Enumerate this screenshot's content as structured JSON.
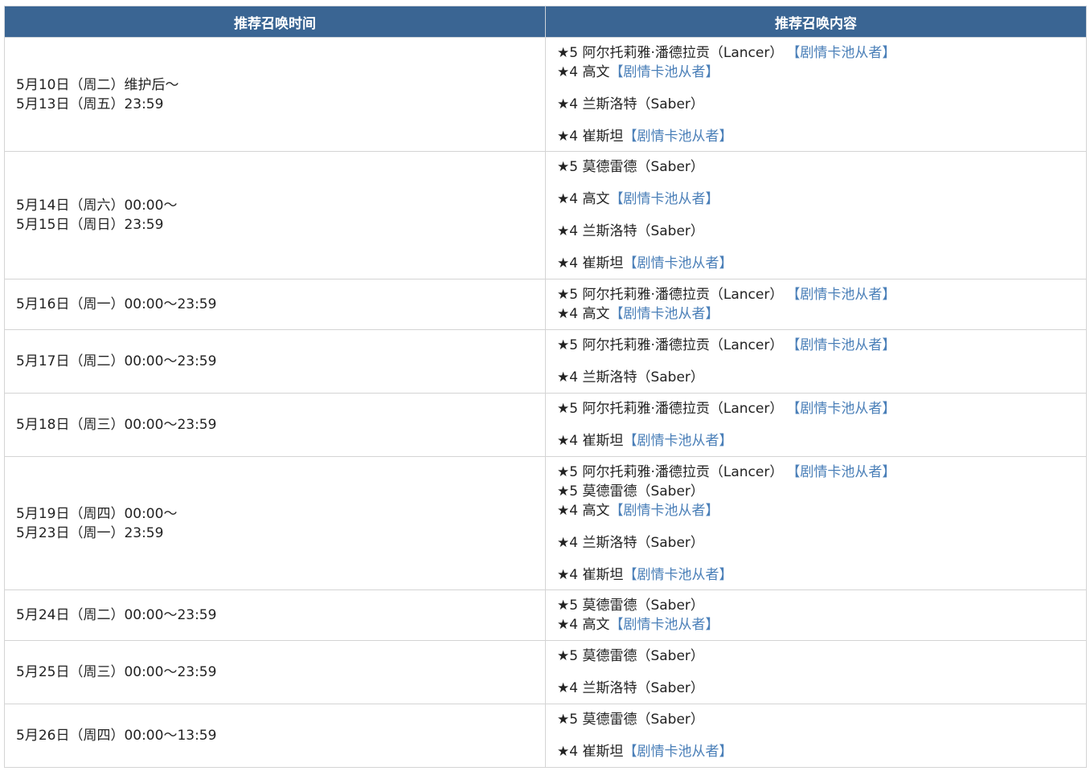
{
  "header": {
    "time_col": "推荐召唤时间",
    "content_col": "推荐召唤内容"
  },
  "rows": [
    {
      "time": [
        "5月10日（周二）维护后～",
        "5月13日（周五）23:59"
      ],
      "groups": [
        [
          {
            "text": "★5 阿尔托莉雅·潘德拉贡（Lancer）",
            "tag": "【剧情卡池从者】"
          },
          {
            "text": "★4 高文",
            "tag": "【剧情卡池从者】"
          }
        ],
        [
          {
            "text": "★4 兰斯洛特（Saber）",
            "tag": ""
          }
        ],
        [
          {
            "text": "★4 崔斯坦",
            "tag": "【剧情卡池从者】"
          }
        ]
      ]
    },
    {
      "time": [
        "5月14日（周六）00:00～",
        "5月15日（周日）23:59"
      ],
      "groups": [
        [
          {
            "text": "★5 莫德雷德（Saber）",
            "tag": ""
          }
        ],
        [
          {
            "text": "★4 高文",
            "tag": "【剧情卡池从者】"
          }
        ],
        [
          {
            "text": "★4 兰斯洛特（Saber）",
            "tag": ""
          }
        ],
        [
          {
            "text": "★4 崔斯坦",
            "tag": "【剧情卡池从者】"
          }
        ]
      ]
    },
    {
      "time": [
        "5月16日（周一）00:00～23:59"
      ],
      "groups": [
        [
          {
            "text": "★5 阿尔托莉雅·潘德拉贡（Lancer）",
            "tag": "【剧情卡池从者】"
          },
          {
            "text": "★4 高文",
            "tag": "【剧情卡池从者】"
          }
        ]
      ]
    },
    {
      "time": [
        "5月17日（周二）00:00～23:59"
      ],
      "groups": [
        [
          {
            "text": "★5 阿尔托莉雅·潘德拉贡（Lancer）",
            "tag": "【剧情卡池从者】"
          }
        ],
        [
          {
            "text": "★4 兰斯洛特（Saber）",
            "tag": ""
          }
        ]
      ]
    },
    {
      "time": [
        "5月18日（周三）00:00～23:59"
      ],
      "groups": [
        [
          {
            "text": "★5 阿尔托莉雅·潘德拉贡（Lancer）",
            "tag": "【剧情卡池从者】"
          }
        ],
        [
          {
            "text": "★4 崔斯坦",
            "tag": "【剧情卡池从者】"
          }
        ]
      ]
    },
    {
      "time": [
        "5月19日（周四）00:00～",
        "5月23日（周一）23:59"
      ],
      "groups": [
        [
          {
            "text": "★5 阿尔托莉雅·潘德拉贡（Lancer）",
            "tag": "【剧情卡池从者】"
          },
          {
            "text": "★5 莫德雷德（Saber）",
            "tag": ""
          },
          {
            "text": "★4 高文",
            "tag": "【剧情卡池从者】"
          }
        ],
        [
          {
            "text": "★4 兰斯洛特（Saber）",
            "tag": ""
          }
        ],
        [
          {
            "text": "★4 崔斯坦",
            "tag": "【剧情卡池从者】"
          }
        ]
      ]
    },
    {
      "time": [
        "5月24日（周二）00:00～23:59"
      ],
      "groups": [
        [
          {
            "text": "★5 莫德雷德（Saber）",
            "tag": ""
          },
          {
            "text": "★4 高文",
            "tag": "【剧情卡池从者】"
          }
        ]
      ]
    },
    {
      "time": [
        "5月25日（周三）00:00～23:59"
      ],
      "groups": [
        [
          {
            "text": "★5 莫德雷德（Saber）",
            "tag": ""
          }
        ],
        [
          {
            "text": "★4 兰斯洛特（Saber）",
            "tag": ""
          }
        ]
      ]
    },
    {
      "time": [
        "5月26日（周四）00:00～13:59"
      ],
      "groups": [
        [
          {
            "text": "★5 莫德雷德（Saber）",
            "tag": ""
          }
        ],
        [
          {
            "text": "★4 崔斯坦",
            "tag": "【剧情卡池从者】"
          }
        ]
      ]
    }
  ],
  "colors": {
    "header_bg": "#3a6593",
    "header_text": "#ffffff",
    "tag_link": "#4a7fb8",
    "border": "#d4d4d4"
  }
}
